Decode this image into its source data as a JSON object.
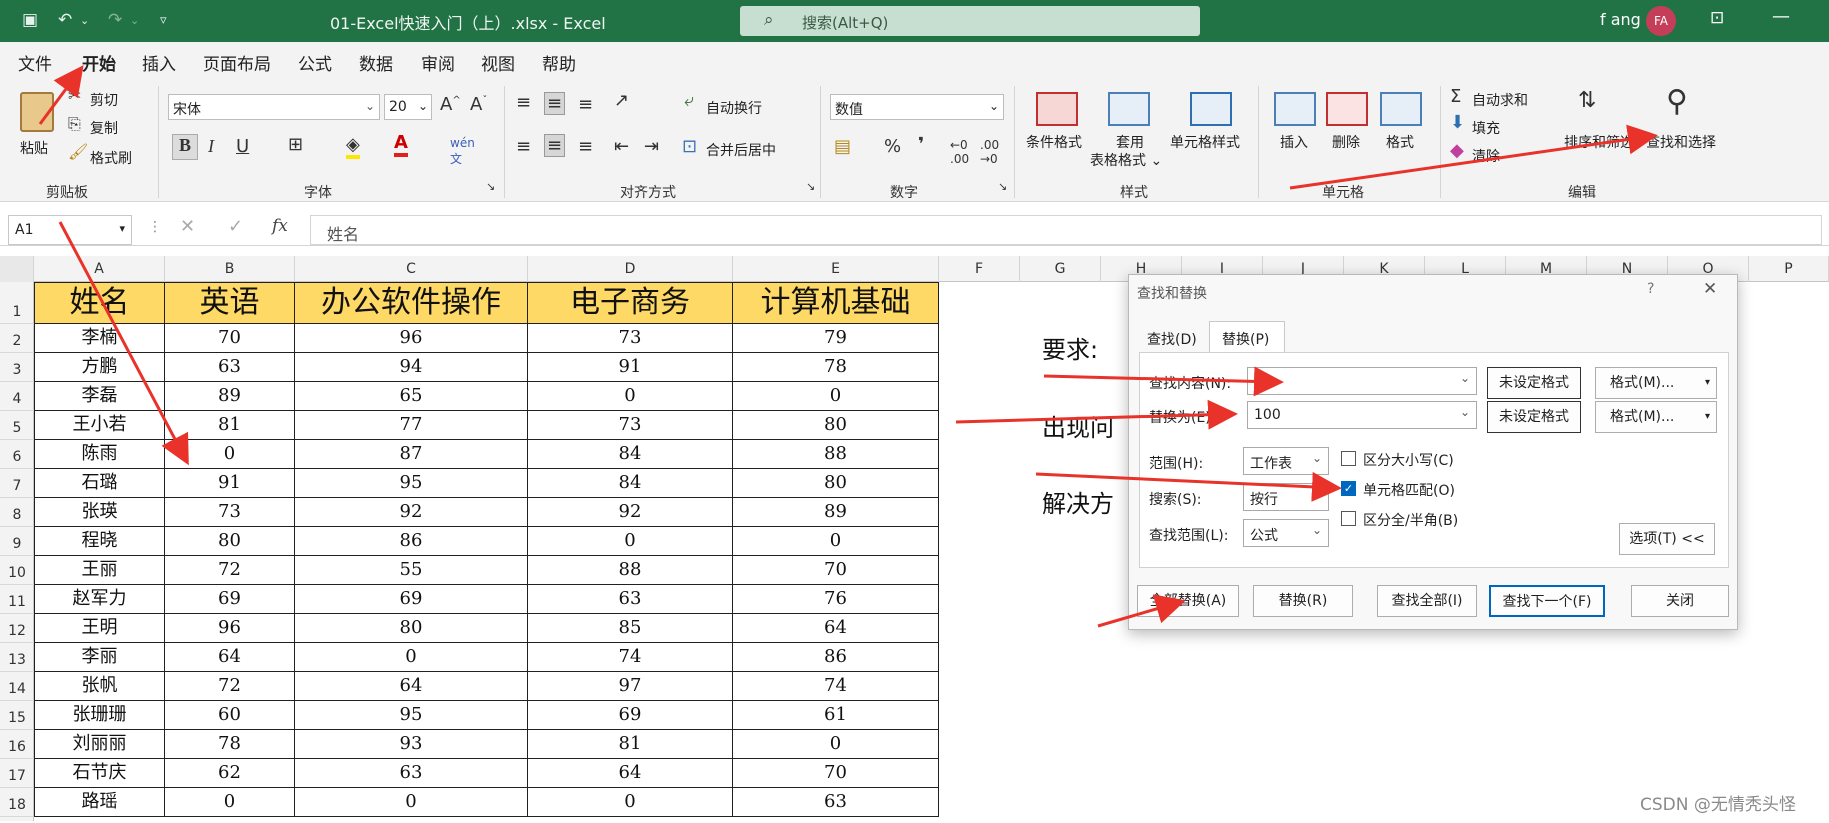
{
  "titlebar": {
    "doc_title": "01-Excel快速入门（上）.xlsx  -  Excel",
    "search_placeholder": "搜索(Alt+Q)",
    "user_name": "f ang",
    "avatar_initials": "FA",
    "accent": "#217346"
  },
  "menu": [
    "文件",
    "开始",
    "插入",
    "页面布局",
    "公式",
    "数据",
    "审阅",
    "视图",
    "帮助"
  ],
  "ribbon": {
    "clipboard": {
      "paste": "粘贴",
      "cut": "剪切",
      "copy": "复制",
      "format_painter": "格式刷",
      "group": "剪贴板"
    },
    "font": {
      "name": "宋体",
      "size": "20",
      "group": "字体"
    },
    "align": {
      "wrap": "自动换行",
      "merge": "合并后居中",
      "group": "对齐方式"
    },
    "number": {
      "format": "数值",
      "group": "数字"
    },
    "styles": {
      "cond": "条件格式",
      "table": "套用\n表格格式",
      "cell": "单元格样式",
      "group": "样式"
    },
    "cells": {
      "insert": "插入",
      "delete": "删除",
      "format": "格式",
      "group": "单元格"
    },
    "editing": {
      "autosum": "自动求和",
      "fill": "填充",
      "clear": "清除",
      "sort": "排序和筛选",
      "find": "查找和选择",
      "group": "编辑"
    }
  },
  "formula_bar": {
    "name_box": "A1",
    "fx": "fx",
    "content": "姓名"
  },
  "columns": [
    "A",
    "B",
    "C",
    "D",
    "E",
    "F",
    "G",
    "H",
    "I",
    "J",
    "K",
    "L",
    "M",
    "N",
    "O",
    "P"
  ],
  "table": {
    "headers": [
      "姓名",
      "英语",
      "办公软件操作",
      "电子商务",
      "计算机基础"
    ],
    "rows": [
      [
        "李楠",
        "70",
        "96",
        "73",
        "79"
      ],
      [
        "方鹏",
        "63",
        "94",
        "91",
        "78"
      ],
      [
        "李磊",
        "89",
        "65",
        "0",
        "0"
      ],
      [
        "王小若",
        "81",
        "77",
        "73",
        "80"
      ],
      [
        "陈雨",
        "0",
        "87",
        "84",
        "88"
      ],
      [
        "石璐",
        "91",
        "95",
        "84",
        "80"
      ],
      [
        "张瑛",
        "73",
        "92",
        "92",
        "89"
      ],
      [
        "程晓",
        "80",
        "86",
        "0",
        "0"
      ],
      [
        "王丽",
        "72",
        "55",
        "88",
        "70"
      ],
      [
        "赵军力",
        "69",
        "69",
        "63",
        "76"
      ],
      [
        "王明",
        "96",
        "80",
        "85",
        "64"
      ],
      [
        "李丽",
        "64",
        "0",
        "74",
        "86"
      ],
      [
        "张帆",
        "72",
        "64",
        "97",
        "74"
      ],
      [
        "张珊珊",
        "60",
        "95",
        "69",
        "61"
      ],
      [
        "刘丽丽",
        "78",
        "93",
        "81",
        "0"
      ],
      [
        "石节庆",
        "62",
        "63",
        "64",
        "70"
      ],
      [
        "路瑶",
        "0",
        "0",
        "0",
        "63"
      ]
    ]
  },
  "side_text": [
    "要求:",
    "出现问",
    "解决方"
  ],
  "dialog": {
    "title": "查找和替换",
    "help": "?",
    "close": "✕",
    "tabs": [
      "查找(D)",
      "替换(P)"
    ],
    "find_label": "查找内容(N):",
    "find_value": "0",
    "replace_label": "替换为(E):",
    "replace_value": "100",
    "no_format": "未设定格式",
    "format_btn": "格式(M)...",
    "scope_label": "范围(H):",
    "scope_value": "工作表",
    "search_label": "搜索(S):",
    "search_value": "按行",
    "lookin_label": "查找范围(L):",
    "lookin_value": "公式",
    "case": "区分大小写(C)",
    "match_cell": "单元格匹配(O)",
    "width": "区分全/半角(B)",
    "options": "选项(T) <<",
    "replace_all": "全部替换(A)",
    "replace": "替换(R)",
    "find_all": "查找全部(I)",
    "find_next": "查找下一个(F)",
    "close_btn": "关闭"
  },
  "watermark": "CSDN @无情秃头怪"
}
